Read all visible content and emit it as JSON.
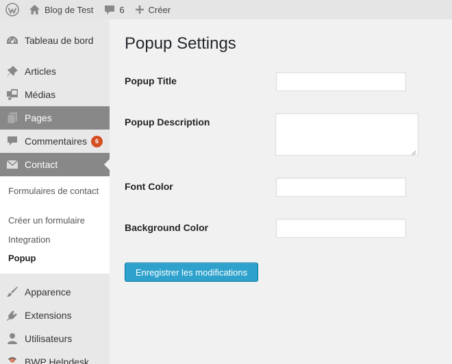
{
  "admin_bar": {
    "site_name": "Blog de Test",
    "comments_count": "6",
    "new_label": "Créer"
  },
  "sidebar": {
    "items": [
      {
        "label": "Tableau de bord",
        "icon": "dashboard-icon"
      },
      {
        "label": "Articles",
        "icon": "pin-icon"
      },
      {
        "label": "Médias",
        "icon": "media-icon"
      },
      {
        "label": "Pages",
        "icon": "pages-icon"
      },
      {
        "label": "Commentaires",
        "icon": "comment-icon",
        "badge": "6"
      },
      {
        "label": "Contact",
        "icon": "mail-icon"
      },
      {
        "label": "Apparence",
        "icon": "brush-icon"
      },
      {
        "label": "Extensions",
        "icon": "plugin-icon"
      },
      {
        "label": "Utilisateurs",
        "icon": "user-icon"
      },
      {
        "label": "BWP Helpdesk",
        "icon": "helpdesk-icon"
      }
    ],
    "submenu": [
      {
        "label": "Formulaires de contact"
      },
      {
        "label": "Créer un formulaire"
      },
      {
        "label": "Integration"
      },
      {
        "label": "Popup"
      }
    ]
  },
  "main": {
    "title": "Popup Settings",
    "fields": {
      "popup_title": {
        "label": "Popup Title",
        "value": ""
      },
      "popup_description": {
        "label": "Popup Description",
        "value": ""
      },
      "font_color": {
        "label": "Font Color",
        "value": ""
      },
      "background_color": {
        "label": "Background Color",
        "value": ""
      }
    },
    "submit_label": "Enregistrer les modifications"
  },
  "colors": {
    "primary_button": "#2ea2cc",
    "badge": "#d54e21",
    "sidebar_active": "#888888"
  }
}
